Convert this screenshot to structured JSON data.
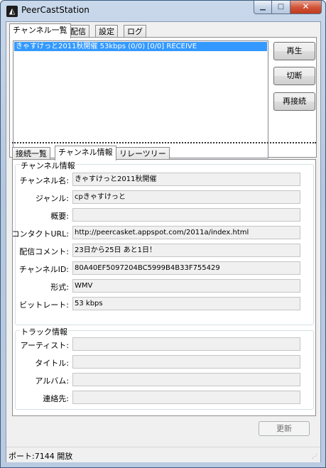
{
  "window": {
    "title": "PeerCastStation",
    "icon": "peercast-app-icon"
  },
  "top_tabs": [
    {
      "label": "チャンネル一覧",
      "active": true
    },
    {
      "label": "配信",
      "active": false
    },
    {
      "label": "設定",
      "active": false
    },
    {
      "label": "ログ",
      "active": false
    }
  ],
  "channel_list": {
    "items": [
      "きゃすけっと2011秋開催 53kbps (0/0) [0/0] RECEIVE"
    ]
  },
  "side_buttons": {
    "play": "再生",
    "disconnect": "切断",
    "reconnect": "再接続"
  },
  "bottom_tabs": [
    {
      "label": "接続一覧",
      "active": false
    },
    {
      "label": "チャンネル情報",
      "active": true
    },
    {
      "label": "リレーツリー",
      "active": false
    }
  ],
  "channel_info": {
    "legend": "チャンネル情報",
    "fields": [
      {
        "label": "チャンネル名:",
        "value": "きゃすけっと2011秋開催"
      },
      {
        "label": "ジャンル:",
        "value": "cpきゃすけっと"
      },
      {
        "label": "概要:",
        "value": ""
      },
      {
        "label": "コンタクトURL:",
        "value": "http://peercasket.appspot.com/2011a/index.html"
      },
      {
        "label": "配信コメント:",
        "value": "23日から25日 あと1日！"
      },
      {
        "label": "チャンネルID:",
        "value": "80A40EF5097204BC5999B4B33F755429"
      },
      {
        "label": "形式:",
        "value": "WMV"
      },
      {
        "label": "ビットレート:",
        "value": "53 kbps"
      }
    ]
  },
  "track_info": {
    "legend": "トラック情報",
    "fields": [
      {
        "label": "アーティスト:",
        "value": ""
      },
      {
        "label": "タイトル:",
        "value": ""
      },
      {
        "label": "アルバム:",
        "value": ""
      },
      {
        "label": "連絡先:",
        "value": ""
      }
    ]
  },
  "update_button": "更新",
  "status": {
    "text": "ポート:7144 開放"
  },
  "colors": {
    "selection": "#3399ff",
    "close_button": "#c0391c"
  }
}
